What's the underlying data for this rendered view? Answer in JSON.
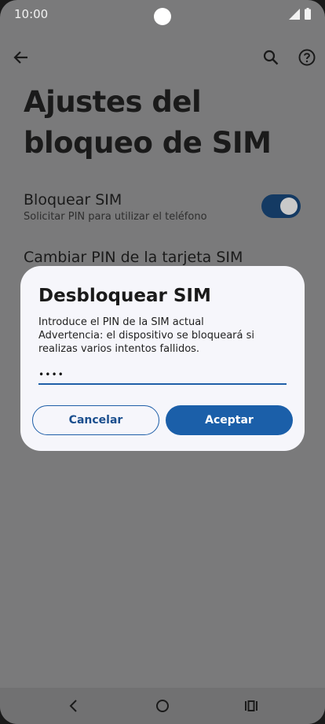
{
  "status_bar": {
    "time": "10:00"
  },
  "header": {
    "title": "Ajustes del bloqueo de SIM"
  },
  "settings": {
    "lock_sim": {
      "title": "Bloquear SIM",
      "subtitle": "Solicitar PIN para utilizar el teléfono",
      "enabled": true
    },
    "change_pin": {
      "title": "Cambiar PIN de la tarjeta SIM"
    }
  },
  "dialog": {
    "title": "Desbloquear SIM",
    "line1": "Introduce el PIN de la SIM actual",
    "line2": "Advertencia: el dispositivo se bloqueará si realizas varios intentos fallidos.",
    "pin_value": "••••",
    "cancel_label": "Cancelar",
    "ok_label": "Aceptar"
  },
  "colors": {
    "accent": "#1b5fa9",
    "toggle_on": "#143a63",
    "scrim": "#7a7a7b",
    "dialog_bg": "#f6f6fb"
  },
  "icons": [
    "back-arrow-icon",
    "search-icon",
    "help-icon",
    "signal-icon",
    "battery-icon",
    "nav-back-icon",
    "nav-home-icon",
    "nav-recents-icon"
  ]
}
